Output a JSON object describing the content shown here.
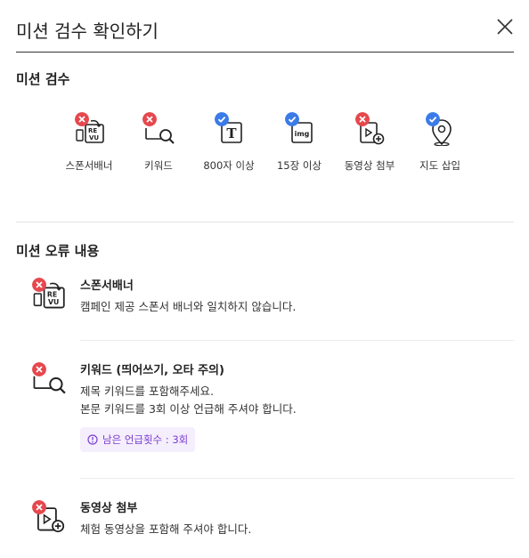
{
  "header": {
    "title": "미션 검수 확인하기"
  },
  "checks_section": {
    "title": "미션 검수",
    "items": [
      {
        "label": "스폰서배너",
        "status": "fail",
        "icon": "sponsor-banner-icon"
      },
      {
        "label": "키워드",
        "status": "fail",
        "icon": "keyword-search-icon"
      },
      {
        "label": "800자 이상",
        "status": "pass",
        "icon": "text-icon"
      },
      {
        "label": "15장 이상",
        "status": "pass",
        "icon": "image-icon"
      },
      {
        "label": "동영상 첨부",
        "status": "fail",
        "icon": "video-attach-icon"
      },
      {
        "label": "지도 삽입",
        "status": "pass",
        "icon": "map-pin-icon"
      }
    ]
  },
  "errors_section": {
    "title": "미션 오류 내용",
    "items": [
      {
        "title": "스폰서배너",
        "lines": [
          "캠페인 제공 스폰서 배너와 일치하지 않습니다."
        ]
      },
      {
        "title": "키워드 (띄어쓰기, 오타 주의)",
        "lines": [
          "제목 키워드를 포함해주세요.",
          "본문 키워드를 3회 이상 언급해 주셔야 합니다."
        ],
        "chip": "남은 언급횟수 : 3회"
      },
      {
        "title": "동영상 첨부",
        "lines": [
          "체험 동영상을 포함해 주셔야 합니다."
        ]
      }
    ]
  },
  "colors": {
    "fail": "#e5484d",
    "pass": "#3b7be8",
    "chip_bg": "#f5eefc",
    "chip_text": "#7a3fd1"
  }
}
